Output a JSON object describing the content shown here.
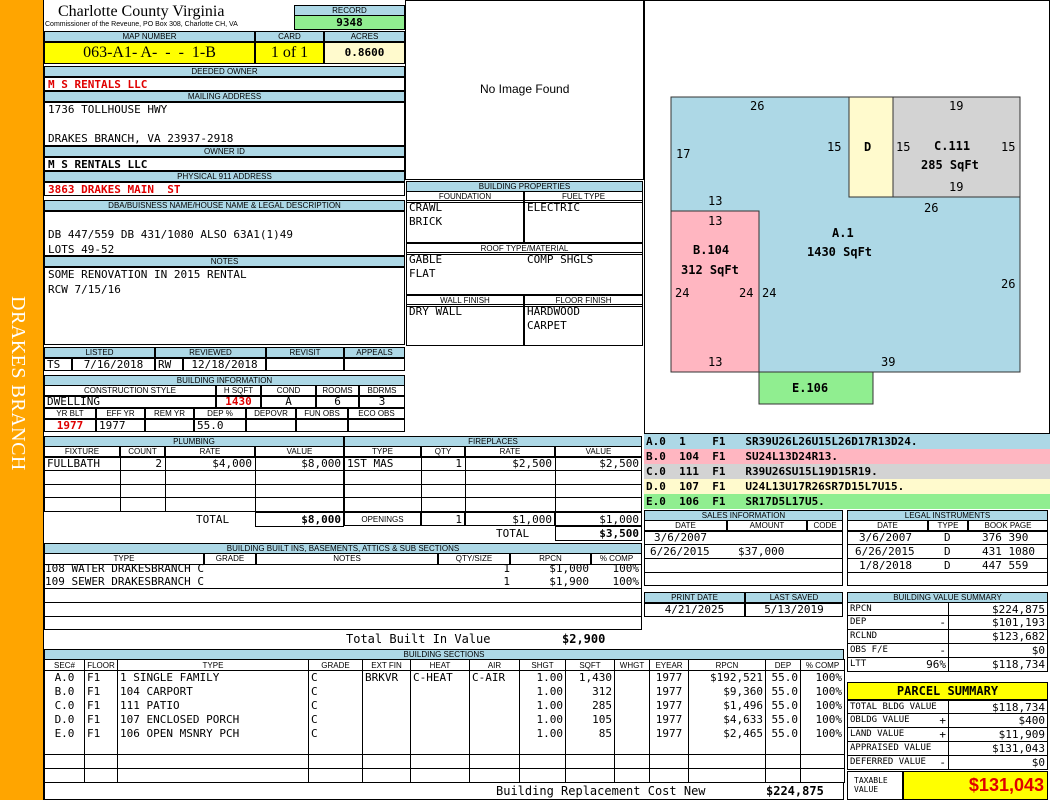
{
  "sidebar": {
    "text": "DRAKES BRANCH"
  },
  "header": {
    "county": "Charlotte County Virginia",
    "commissioner": "Commissioner of the Reveune, PO Box 308, Charlotte CH, VA",
    "record_label": "RECORD",
    "record_value": "9348"
  },
  "map": {
    "map_label": "MAP NUMBER",
    "map_value": "063-A1- A-  -  -  1-B",
    "card_label": "CARD",
    "card_value": "1 of 1",
    "acres_label": "ACRES",
    "acres_value": "0.8600"
  },
  "owner": {
    "deeded_label": "DEEDED OWNER",
    "deeded_value": "M S RENTALS LLC",
    "mailing_label": "MAILING ADDRESS",
    "mailing_line1": "1736 TOLLHOUSE HWY",
    "mailing_line2": "DRAKES BRANCH, VA 23937-2918",
    "owner_id_label": "OWNER ID",
    "owner_id_value": "M S RENTALS LLC",
    "physical_label": "PHYSICAL 911 ADDRESS",
    "physical_value": "3863 DRAKES MAIN  ST",
    "dba_label": "DBA/BUISNESS NAME/HOUSE NAME & LEGAL DESCRIPTION",
    "dba_line1": "DB 447/559 DB 431/1080 ALSO 63A1(1)49",
    "dba_line2": "LOTS 49-52",
    "notes_label": "NOTES",
    "notes_line1": "SOME RENOVATION IN 2015 RENTAL",
    "notes_line2": "RCW 7/15/16"
  },
  "image": {
    "text": "No Image Found"
  },
  "props": {
    "title": "BUILDING PROPERTIES",
    "foundation_label": "FOUNDATION",
    "fuel_label": "FUEL TYPE",
    "foundation_1": "CRAWL",
    "foundation_2": "BRICK",
    "fuel_1": "ELECTRIC",
    "roof_label": "ROOF TYPE/MATERIAL",
    "roof_1": "GABLE",
    "roof_2": "FLAT",
    "roof_3": "COMP SHGLS",
    "wall_label": "WALL FINISH",
    "floor_label": "FLOOR FINISH",
    "wall_1": "DRY WALL",
    "floor_1": "HARDWOOD",
    "floor_2": "CARPET"
  },
  "review": {
    "listed_label": "LISTED",
    "reviewed_label": "REVIEWED",
    "revisit_label": "REVISIT",
    "appeals_label": "APPEALS",
    "listed_by": "TS",
    "listed_date": "7/16/2018",
    "reviewed_by": "RW",
    "reviewed_date": "12/18/2018"
  },
  "bldg_info": {
    "title": "BUILDING INFORMATION",
    "style_label": "CONSTRUCTION STYLE",
    "hsqft_label": "H SQFT",
    "cond_label": "COND",
    "rooms_label": "ROOMS",
    "bdrms_label": "BDRMS",
    "style": "DWELLING",
    "hsqft": "1430",
    "cond": "A",
    "rooms": "6",
    "bdrms": "3",
    "yrblt_label": "YR BLT",
    "effyr_label": "EFF YR",
    "remyr_label": "REM YR",
    "dep_label": "DEP %",
    "depovr_label": "DEPOVR",
    "funobs_label": "FUN OBS",
    "ecoobs_label": "ECO OBS",
    "yrblt": "1977",
    "effyr": "1977",
    "dep": "55.0"
  },
  "plumbing": {
    "title": "PLUMBING",
    "cols": [
      "FIXTURE",
      "COUNT",
      "RATE",
      "VALUE"
    ],
    "row": [
      "FULLBATH",
      "2",
      "$4,000",
      "$8,000"
    ],
    "total_label": "TOTAL",
    "total_value": "$8,000"
  },
  "fireplaces": {
    "title": "FIREPLACES",
    "cols": [
      "TYPE",
      "QTY",
      "RATE",
      "VALUE"
    ],
    "row": [
      "1ST MAS",
      "1",
      "$2,500",
      "$2,500"
    ],
    "openings_label": "OPENINGS",
    "openings": [
      "1",
      "$1,000",
      "$1,000"
    ],
    "total_label": "TOTAL",
    "total_value": "$3,500"
  },
  "builtins": {
    "title": "BUILDING BUILT INS, BASEMENTS, ATTICS & SUB SECTIONS",
    "cols": [
      "TYPE",
      "GRADE",
      "NOTES",
      "QTY/SIZE",
      "RPCN",
      "% COMP"
    ],
    "rows": [
      [
        "108 WATER DRAKESBRANCH C",
        "1",
        "$1,000",
        "100%"
      ],
      [
        "109 SEWER DRAKESBRANCH C",
        "1",
        "$1,900",
        "100%"
      ]
    ],
    "total_label": "Total Built In Value",
    "total_value": "$2,900"
  },
  "sections": {
    "title": "BUILDING SECTIONS",
    "cols": [
      "SEC#",
      "FLOOR",
      "TYPE",
      "GRADE",
      "EXT FIN",
      "HEAT",
      "AIR",
      "SHGT",
      "SQFT",
      "WHGT",
      "EYEAR",
      "RPCN",
      "DEP",
      "% COMP"
    ],
    "rows": [
      [
        "A.0",
        "F1",
        "1 SINGLE FAMILY",
        "C",
        "BRKVR",
        "C-HEAT",
        "C-AIR",
        "1.00",
        "1,430",
        "",
        "1977",
        "$192,521",
        "55.0",
        "100%"
      ],
      [
        "B.0",
        "F1",
        "104 CARPORT",
        "C",
        "",
        "",
        "",
        "1.00",
        "312",
        "",
        "1977",
        "$9,360",
        "55.0",
        "100%"
      ],
      [
        "C.0",
        "F1",
        "111 PATIO",
        "C",
        "",
        "",
        "",
        "1.00",
        "285",
        "",
        "1977",
        "$1,496",
        "55.0",
        "100%"
      ],
      [
        "D.0",
        "F1",
        "107 ENCLOSED PORCH",
        "C",
        "",
        "",
        "",
        "1.00",
        "105",
        "",
        "1977",
        "$4,633",
        "55.0",
        "100%"
      ],
      [
        "E.0",
        "F1",
        "106 OPEN MSNRY PCH",
        "C",
        "",
        "",
        "",
        "1.00",
        "85",
        "",
        "1977",
        "$2,465",
        "55.0",
        "100%"
      ]
    ],
    "footer_label": "Building Replacement Cost New",
    "footer_value": "$224,875"
  },
  "sketch": {
    "labels": {
      "a_top": "26",
      "a_left": "17",
      "a_15": "15",
      "d": "D",
      "c_left": "15",
      "c_right": "15",
      "c_top": "19",
      "c_bottom": "19",
      "c_name": "C.111",
      "c_area": "285 SqFt",
      "a_26_mid": "26",
      "b_top_out": "13",
      "b_top_in": "13",
      "b_name": "B.104",
      "b_area": "312 SqFt",
      "b_left": "24",
      "b_right": "24",
      "a_24": "24",
      "a_name": "A.1",
      "a_area": "1430 SqFt",
      "a_right": "26",
      "b_bottom": "13",
      "a_bottom": "39",
      "e_name": "E.106"
    },
    "colors": {
      "a": "#add8e6",
      "b": "#ffb6c1",
      "c": "#d3d3d3",
      "d": "#fffacd",
      "e": "#90ee90"
    },
    "legend": [
      {
        "text": "A.0  1    F1   SR39U26L26U15L26D17R13D24.",
        "color": "#add8e6"
      },
      {
        "text": "B.0  104  F1   SU24L13D24R13.",
        "color": "#ffb6c1"
      },
      {
        "text": "C.0  111  F1   R39U26SU15L19D15R19.",
        "color": "#d3d3d3"
      },
      {
        "text": "D.0  107  F1   U24L13U17R26SR7D15L7U15.",
        "color": "#fffacd"
      },
      {
        "text": "E.0  106  F1   SR17D5L17U5.",
        "color": "#90ee90"
      }
    ]
  },
  "sales": {
    "title": "SALES INFORMATION",
    "cols": [
      "DATE",
      "AMOUNT",
      "CODE"
    ],
    "rows": [
      [
        "3/6/2007",
        "",
        ""
      ],
      [
        "6/26/2015",
        "$37,000",
        ""
      ]
    ]
  },
  "legal": {
    "title": "LEGAL INSTRUMENTS",
    "cols": [
      "DATE",
      "TYPE",
      "BOOK PAGE"
    ],
    "rows": [
      [
        "3/6/2007",
        "D",
        "376 390"
      ],
      [
        "6/26/2015",
        "D",
        "431 1080"
      ],
      [
        "1/8/2018",
        "D",
        "447 559"
      ]
    ]
  },
  "print": {
    "print_label": "PRINT DATE",
    "saved_label": "LAST SAVED",
    "print_value": "4/21/2025",
    "saved_value": "5/13/2019"
  },
  "value_summary": {
    "title": "BUILDING VALUE SUMMARY",
    "rows": [
      [
        "RPCN",
        "",
        "$224,875"
      ],
      [
        "DEP",
        "-",
        "$101,193"
      ],
      [
        "RCLND",
        "",
        "$123,682"
      ],
      [
        "OBS F/E",
        "-",
        "$0"
      ],
      [
        "LTT",
        "96%",
        "$118,734"
      ]
    ]
  },
  "parcel": {
    "title": "PARCEL SUMMARY",
    "rows": [
      [
        "TOTAL BLDG VALUE",
        "",
        "$118,734"
      ],
      [
        "OBLDG VALUE",
        "+",
        "$400"
      ],
      [
        "LAND VALUE",
        "+",
        "$11,909"
      ],
      [
        "APPRAISED VALUE",
        "",
        "$131,043"
      ],
      [
        "DEFERRED VALUE",
        "-",
        "$0"
      ]
    ],
    "taxable_label": "TAXABLE VALUE",
    "taxable_value": "$131,043"
  }
}
